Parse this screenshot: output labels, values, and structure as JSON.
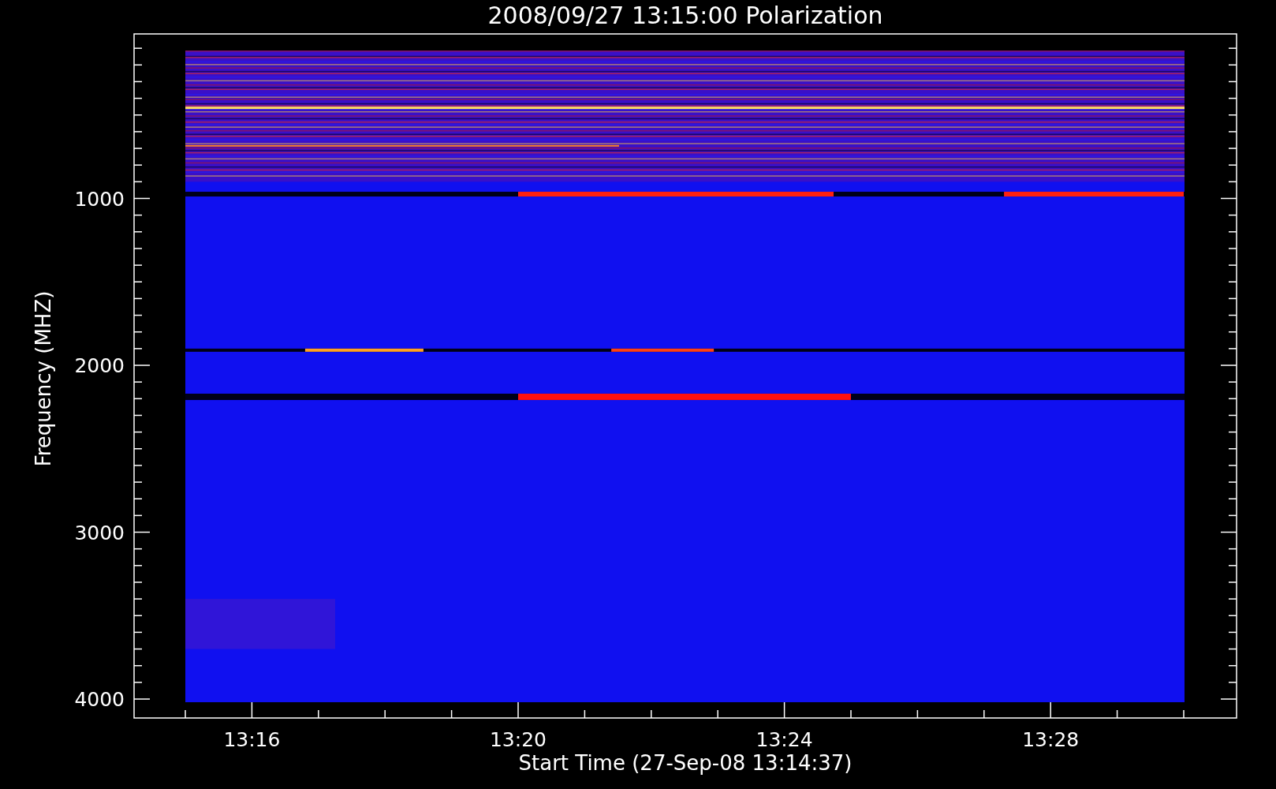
{
  "plot": {
    "title": "2008/09/27 13:15:00 Polarization",
    "y_axis": {
      "label": "Frequency (MHZ)",
      "tick_labels": [
        "1000",
        "2000",
        "3000",
        "4000"
      ]
    },
    "x_axis": {
      "label": "Start Time (27-Sep-08 13:14:37)",
      "tick_labels": [
        "13:16",
        "13:20",
        "13:24",
        "13:28"
      ]
    }
  }
}
